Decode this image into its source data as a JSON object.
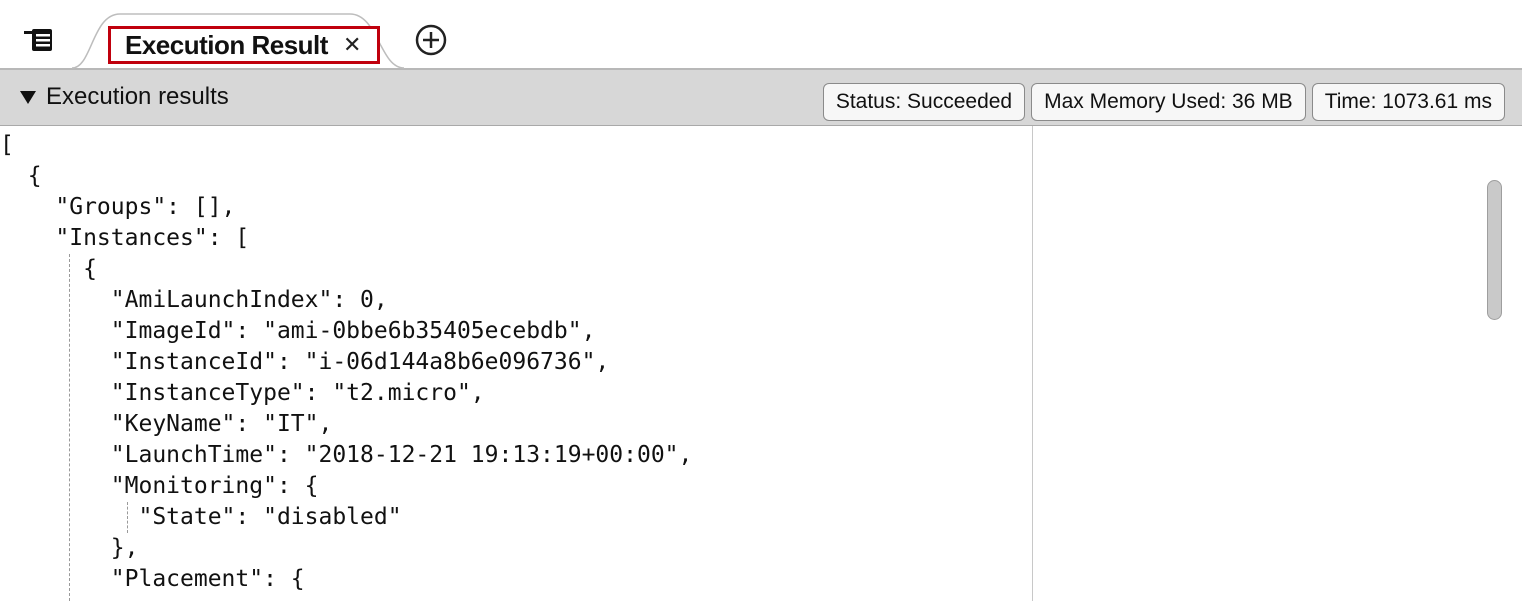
{
  "tabbar": {
    "active_tab": {
      "title": "Execution Result",
      "close_glyph": "✕"
    },
    "icons": {
      "tabs_menu": "tabs-list-icon",
      "add_tab": "plus-circle-icon"
    }
  },
  "header": {
    "collapse_icon": "triangle-down-icon",
    "title": "Execution results",
    "badges": {
      "status": "Status: Succeeded",
      "memory": "Max Memory Used: 36 MB",
      "time": "Time: 1073.61 ms"
    }
  },
  "code": {
    "lines": [
      "[",
      "  {",
      "    \"Groups\": [],",
      "    \"Instances\": [",
      "      {",
      "        \"AmiLaunchIndex\": 0,",
      "        \"ImageId\": \"ami-0bbe6b35405ecebdb\",",
      "        \"InstanceId\": \"i-06d144a8b6e096736\",",
      "        \"InstanceType\": \"t2.micro\",",
      "        \"KeyName\": \"IT\",",
      "        \"LaunchTime\": \"2018-12-21 19:13:19+00:00\",",
      "        \"Monitoring\": {",
      "          \"State\": \"disabled\"",
      "        },",
      "        \"Placement\": {"
    ]
  },
  "colors": {
    "active_tab_border": "#c0000d",
    "header_bg": "#d7d7d7",
    "badge_bg": "#f7f7f7"
  }
}
